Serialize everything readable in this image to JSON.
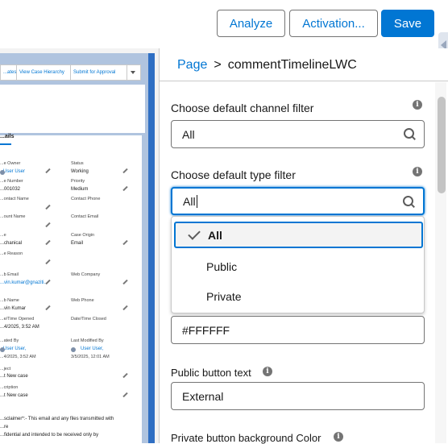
{
  "toolbar": {
    "analyze_label": "Analyze",
    "activation_label": "Activation...",
    "save_label": "Save"
  },
  "canvas": {
    "actions": [
      "...ates",
      "View Case Hierarchy",
      "Submit for Approval"
    ],
    "tab_label": "...ails",
    "fields": [
      {
        "label": "...e Owner",
        "value": "User User"
      },
      {
        "label": "Status",
        "value": "Working"
      },
      {
        "label": "...e Number",
        "value": "...001032"
      },
      {
        "label": "Priority",
        "value": "Medium"
      },
      {
        "label": "...ontact Name",
        "value": ""
      },
      {
        "label": "Contact Phone",
        "value": ""
      },
      {
        "label": "...ount Name",
        "value": ""
      },
      {
        "label": "Contact Email",
        "value": ""
      },
      {
        "label": "...e",
        "value": "...chanical"
      },
      {
        "label": "Case Origin",
        "value": "Email"
      },
      {
        "label": "...e Reason",
        "value": ""
      },
      {
        "label": "...b Email",
        "value": "...vin.kumar@gnaziti..."
      },
      {
        "label": "Web Company",
        "value": ""
      },
      {
        "label": "...b Name",
        "value": "...vin Kumar"
      },
      {
        "label": "Web Phone",
        "value": ""
      },
      {
        "label": "...e/Time Opened",
        "value": "...4/2025, 3:52 AM"
      },
      {
        "label": "Date/Time Closed",
        "value": ""
      },
      {
        "label": "...ated By",
        "value": "User User,"
      },
      {
        "label": "...4/2025, 3:52 AM",
        "value": ""
      },
      {
        "label": "Last Modified By",
        "value": "User User,"
      },
      {
        "label": "3/5/2025, 12:01 AM",
        "value": ""
      },
      {
        "label": "...ject",
        "value": "...t New case"
      },
      {
        "label": "...cription",
        "value": "...t New case"
      }
    ],
    "disclaimer_line1": "...sclaimer*:- This email and any files transmitted with",
    "disclaimer_line2": "...re",
    "disclaimer_line3": "...fidential and intended to be received only by"
  },
  "props": {
    "breadcrumb_page": "Page",
    "breadcrumb_sep": ">",
    "breadcrumb_component": "commentTimelineLWC",
    "channel_filter_label": "Choose default channel filter",
    "channel_filter_value": "All",
    "type_filter_label": "Choose default type filter",
    "type_filter_value": "All",
    "type_options": [
      "All",
      "Public",
      "Private"
    ],
    "type_selected": "All",
    "hex_value": "#FFFFFF",
    "public_button_text_label": "Public button text",
    "public_button_text_value": "External",
    "private_button_bg_label": "Private button background Color"
  },
  "colors": {
    "brand": "#0176d3",
    "border": "#747474"
  }
}
